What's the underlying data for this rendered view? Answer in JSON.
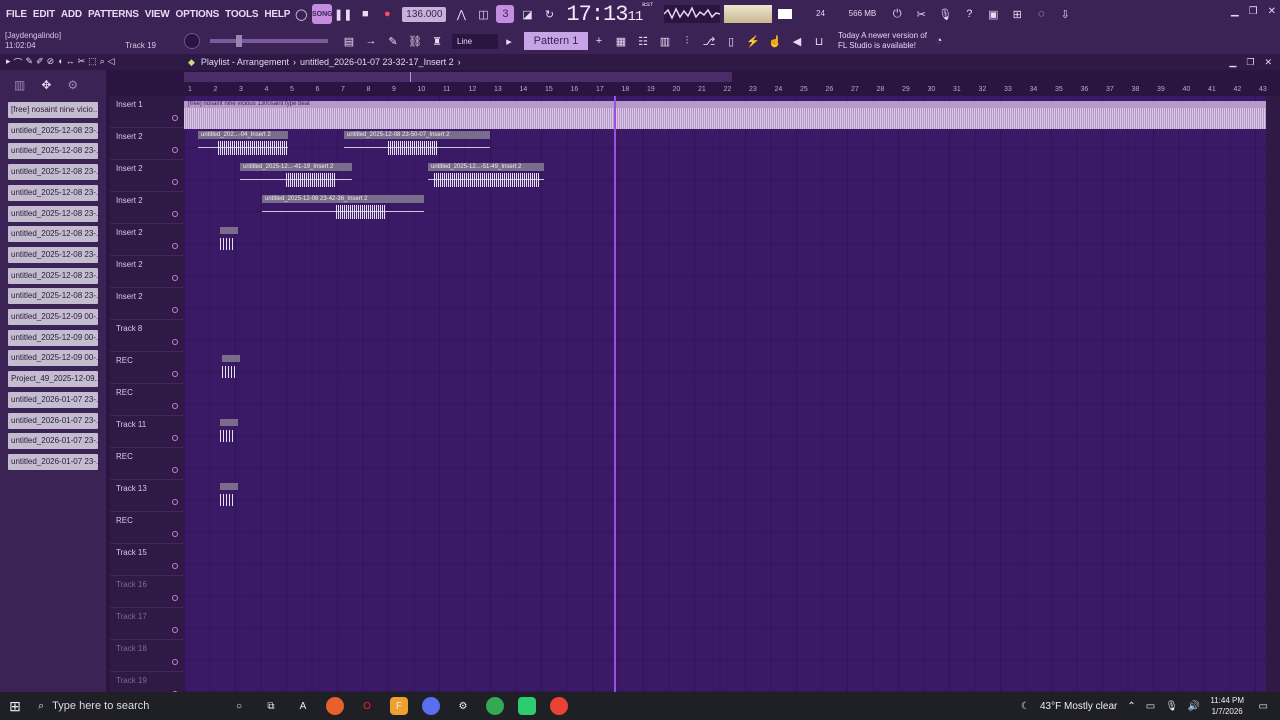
{
  "menu": [
    "FILE",
    "EDIT",
    "ADD",
    "PATTERNS",
    "VIEW",
    "OPTIONS",
    "TOOLS",
    "HELP"
  ],
  "transport": {
    "song_label": "SONG",
    "tempo": "136.000",
    "time": "17:13",
    "time_ticks": "11",
    "time_sub": "B:S:T"
  },
  "stats": {
    "cpu": "24",
    "mem": "566 MB",
    "poly": "1"
  },
  "hint": {
    "user": "[Jaydengalindo]",
    "time": "11:02:04",
    "track": "Track 19"
  },
  "snap": "Line",
  "pattern": "Pattern 1",
  "news": {
    "when": "Today",
    "message": "A newer version of FL Studio is available!"
  },
  "playlist": {
    "title": "Playlist - Arrangement",
    "breadcrumb": "untitled_2026-01-07 23-32-17_Insert 2",
    "chevron": "›"
  },
  "sidebar_clips": [
    "[free] nosaint  nine vicio...",
    "untitled_2025-12-08 23-...",
    "untitled_2025-12-08 23-...",
    "untitled_2025-12-08 23-...",
    "untitled_2025-12-08 23-...",
    "untitled_2025-12-08 23-...",
    "untitled_2025-12-08 23-...",
    "untitled_2025-12-08 23-...",
    "untitled_2025-12-08 23-...",
    "untitled_2025-12-08 23-...",
    "untitled_2025-12-09 00-...",
    "untitled_2025-12-09 00-...",
    "untitled_2025-12-09 00-...",
    "Project_49_2025-12-09...",
    "untitled_2026-01-07 23-...",
    "untitled_2026-01-07 23-...",
    "untitled_2026-01-07 23-...",
    "untitled_2026-01-07 23-..."
  ],
  "tracks": [
    "Insert 1",
    "Insert 2",
    "Insert 2",
    "Insert 2",
    "Insert 2",
    "Insert 2",
    "Insert 2",
    "Track 8",
    "REC",
    "REC",
    "Track 11",
    "REC",
    "Track 13",
    "REC",
    "Track 15",
    "Track 16",
    "Track 17",
    "Track 18",
    "Track 19"
  ],
  "ruler_ticks": [
    "1",
    "2",
    "3",
    "4",
    "5",
    "6",
    "7",
    "8",
    "9",
    "10",
    "11",
    "12",
    "13",
    "14",
    "15",
    "16",
    "17",
    "18",
    "19",
    "20",
    "21",
    "22",
    "23",
    "24",
    "25",
    "26",
    "27",
    "28",
    "29",
    "30",
    "31",
    "32",
    "33",
    "34",
    "35",
    "36",
    "37",
    "38",
    "39",
    "40",
    "41",
    "42",
    "43"
  ],
  "clips": {
    "beat": "[free] nosaint  nine vicious  1300saint type beat",
    "c1": "untitled_202...-04_Insert 2",
    "c2": "untitled_2025-12-08 23-50-07_Insert 2",
    "c3": "untitled_2025-12...-41-19_Insert 2",
    "c4": "untitled_2025-12...-51-49_Insert 2",
    "c5": "untitled_2025-12-08 23-42-36_Insert 2"
  },
  "taskbar": {
    "search_placeholder": "Type here to search",
    "weather": "43°F  Mostly clear",
    "time": "11:44 PM",
    "date": "1/7/2026"
  }
}
